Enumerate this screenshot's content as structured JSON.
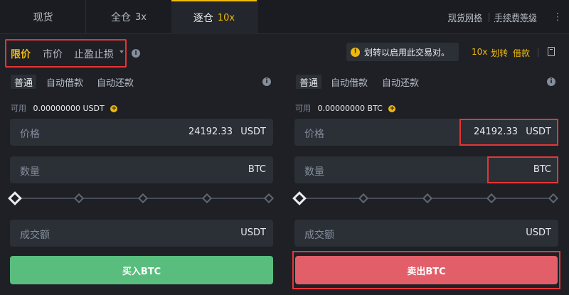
{
  "tabs": [
    {
      "label": "现货",
      "leverage": ""
    },
    {
      "label": "全仓",
      "leverage": "3x"
    },
    {
      "label": "逐仓",
      "leverage": "10x"
    }
  ],
  "top_links": [
    "现货网格",
    "手续费等级"
  ],
  "order_types": [
    "限价",
    "市价",
    "止盈止损"
  ],
  "notice": "划转以启用此交易对。",
  "right_header": {
    "leverage": "10x",
    "transfer": "划转",
    "borrow": "借款"
  },
  "sub_tabs": [
    "普通",
    "自动借款",
    "自动还款"
  ],
  "buy": {
    "available_label": "可用",
    "available_value": "0.00000000 USDT",
    "price_label": "价格",
    "price_value": "24192.33",
    "price_unit": "USDT",
    "amount_label": "数量",
    "amount_unit": "BTC",
    "total_label": "成交额",
    "total_unit": "USDT",
    "slider_level": 0,
    "button_label": "买入BTC"
  },
  "sell": {
    "available_label": "可用",
    "available_value": "0.00000000 BTC",
    "price_label": "价格",
    "price_value": "24192.33",
    "price_unit": "USDT",
    "amount_label": "数量",
    "amount_unit": "BTC",
    "total_label": "成交额",
    "total_unit": "USDT",
    "slider_level": 0,
    "button_label": "卖出BTC"
  },
  "colors": {
    "accent": "#f0b90b",
    "buy": "#58bd7d",
    "sell": "#e25f6a",
    "highlight_box": "#e63535",
    "background": "#1e2026"
  }
}
